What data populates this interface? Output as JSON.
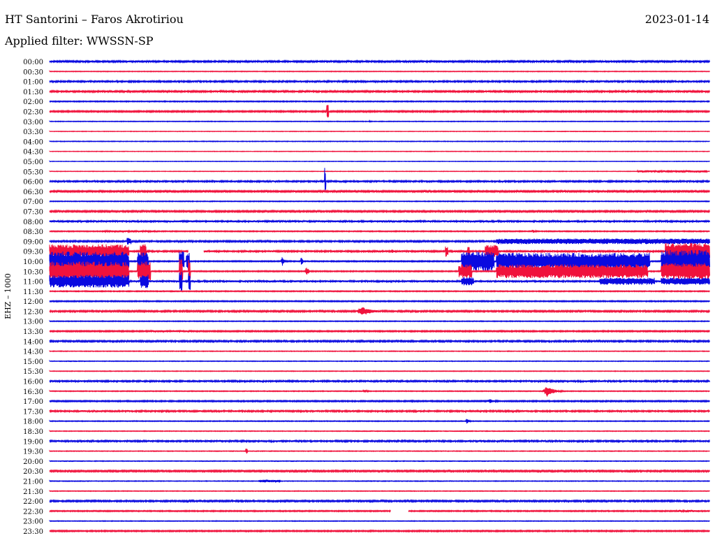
{
  "header": {
    "title": "HT Santorini – Faros Akrotiriou",
    "date": "2023-01-14",
    "filter": "Applied filter: WWSSN-SP"
  },
  "colors": {
    "blue": "#0a0ae0",
    "red": "#f0123c",
    "text": "#000000",
    "background": "#ffffff"
  },
  "chart_data": {
    "type": "line",
    "subtype": "helicorder",
    "ylabel": "EHZ – 1000",
    "row_labels": [
      "00:00",
      "00:30",
      "01:00",
      "01:30",
      "02:00",
      "02:30",
      "03:00",
      "03:30",
      "04:00",
      "04:30",
      "05:00",
      "05:30",
      "06:00",
      "06:30",
      "07:00",
      "07:30",
      "08:00",
      "08:30",
      "09:00",
      "09:30",
      "10:00",
      "10:30",
      "11:00",
      "11:30",
      "12:00",
      "12:30",
      "13:00",
      "13:30",
      "14:00",
      "14:30",
      "15:00",
      "15:30",
      "16:00",
      "16:30",
      "17:00",
      "17:30",
      "18:00",
      "18:30",
      "19:00",
      "19:30",
      "20:00",
      "20:30",
      "21:00",
      "21:30",
      "22:00",
      "22:30",
      "23:00",
      "23:30"
    ],
    "row_colors": [
      "blue",
      "red"
    ],
    "x_unit": "minutes within 30-minute row",
    "x_range": [
      0,
      30
    ],
    "baseline_noise": [
      1.2,
      0.5,
      1.3,
      1.2,
      0.7,
      1.0,
      0.5,
      0.4,
      0.5,
      0.4,
      0.4,
      0.4,
      1.3,
      1.1,
      0.6,
      1.1,
      1.4,
      0.7,
      1.2,
      1.3,
      0.8,
      0.8,
      1.4,
      0.7,
      0.8,
      1.2,
      0.6,
      0.9,
      1.2,
      0.5,
      0.5,
      0.5,
      1.3,
      0.6,
      0.9,
      1.3,
      0.6,
      0.5,
      1.3,
      0.5,
      0.5,
      1.1,
      0.5,
      0.5,
      1.2,
      0.8,
      0.5,
      0.9
    ],
    "events": [
      {
        "row": 5,
        "start": 12.6,
        "duration": 0.08,
        "amp": 10,
        "type": "spike"
      },
      {
        "row": 6,
        "start": 14.5,
        "duration": 0.2,
        "amp": 1.5,
        "type": "burst"
      },
      {
        "row": 11,
        "start": 26.7,
        "duration": 3.2,
        "amp": 1.6,
        "type": "noise"
      },
      {
        "row": 12,
        "start": 12.5,
        "duration": 0.05,
        "amp": 20,
        "type": "spike"
      },
      {
        "row": 17,
        "start": 2.4,
        "duration": 2.5,
        "amp": 1.5,
        "type": "noise"
      },
      {
        "row": 17,
        "start": 21.9,
        "duration": 0.4,
        "amp": 2.5,
        "type": "burst"
      },
      {
        "row": 18,
        "start": 3.5,
        "duration": 0.2,
        "amp": 5,
        "type": "spike"
      },
      {
        "row": 18,
        "start": 20.3,
        "duration": 9.7,
        "amp": 4,
        "type": "noise"
      },
      {
        "row": 19,
        "start": 0.0,
        "duration": 3.6,
        "amp": 10,
        "type": "noise"
      },
      {
        "row": 19,
        "start": 4.1,
        "duration": 0.3,
        "amp": 10,
        "type": "spike"
      },
      {
        "row": 19,
        "start": 15.5,
        "duration": 0.3,
        "amp": 4,
        "type": "burst"
      },
      {
        "row": 19,
        "start": 18.0,
        "duration": 0.1,
        "amp": 8,
        "type": "spike"
      },
      {
        "row": 19,
        "start": 19.0,
        "duration": 0.1,
        "amp": 8,
        "type": "spike"
      },
      {
        "row": 19,
        "start": 19.8,
        "duration": 0.6,
        "amp": 9,
        "type": "noise"
      },
      {
        "row": 19,
        "start": 28.0,
        "duration": 2.0,
        "amp": 12,
        "type": "noise"
      },
      {
        "row": 20,
        "start": 0.0,
        "duration": 3.6,
        "amp": 14,
        "type": "noise"
      },
      {
        "row": 20,
        "start": 4.0,
        "duration": 0.5,
        "amp": 13,
        "type": "noise"
      },
      {
        "row": 20,
        "start": 5.9,
        "duration": 0.2,
        "amp": 14,
        "type": "spike"
      },
      {
        "row": 20,
        "start": 6.2,
        "duration": 0.15,
        "amp": 14,
        "type": "spike"
      },
      {
        "row": 20,
        "start": 10.5,
        "duration": 0.3,
        "amp": 7,
        "type": "burst"
      },
      {
        "row": 20,
        "start": 11.4,
        "duration": 0.1,
        "amp": 5,
        "type": "spike"
      },
      {
        "row": 20,
        "start": 18.7,
        "duration": 1.5,
        "amp": 14,
        "type": "noise"
      },
      {
        "row": 20,
        "start": 20.3,
        "duration": 7.0,
        "amp": 12,
        "type": "noise"
      },
      {
        "row": 20,
        "start": 27.8,
        "duration": 2.2,
        "amp": 16,
        "type": "noise"
      },
      {
        "row": 21,
        "start": 0.0,
        "duration": 3.6,
        "amp": 14,
        "type": "noise"
      },
      {
        "row": 21,
        "start": 4.0,
        "duration": 0.6,
        "amp": 14,
        "type": "noise"
      },
      {
        "row": 21,
        "start": 5.9,
        "duration": 0.15,
        "amp": 18,
        "type": "spike"
      },
      {
        "row": 21,
        "start": 6.3,
        "duration": 0.1,
        "amp": 18,
        "type": "spike"
      },
      {
        "row": 21,
        "start": 11.6,
        "duration": 0.35,
        "amp": 7,
        "type": "burst"
      },
      {
        "row": 21,
        "start": 18.6,
        "duration": 0.6,
        "amp": 10,
        "type": "noise"
      },
      {
        "row": 21,
        "start": 20.3,
        "duration": 6.9,
        "amp": 10,
        "type": "noise"
      },
      {
        "row": 21,
        "start": 27.8,
        "duration": 2.2,
        "amp": 12,
        "type": "noise"
      },
      {
        "row": 22,
        "start": 0.0,
        "duration": 3.6,
        "amp": 9,
        "type": "noise"
      },
      {
        "row": 22,
        "start": 4.1,
        "duration": 0.4,
        "amp": 10,
        "type": "noise"
      },
      {
        "row": 22,
        "start": 5.9,
        "duration": 0.1,
        "amp": 14,
        "type": "spike"
      },
      {
        "row": 22,
        "start": 6.3,
        "duration": 0.1,
        "amp": 14,
        "type": "spike"
      },
      {
        "row": 22,
        "start": 18.7,
        "duration": 0.6,
        "amp": 6,
        "type": "noise"
      },
      {
        "row": 22,
        "start": 25.0,
        "duration": 2.5,
        "amp": 5,
        "type": "noise"
      },
      {
        "row": 22,
        "start": 27.8,
        "duration": 2.2,
        "amp": 5,
        "type": "noise"
      },
      {
        "row": 25,
        "start": 13.9,
        "duration": 1.4,
        "amp": 7,
        "type": "burst"
      },
      {
        "row": 27,
        "start": 4.5,
        "duration": 2.0,
        "amp": 1.5,
        "type": "noise"
      },
      {
        "row": 33,
        "start": 14.2,
        "duration": 0.5,
        "amp": 2.5,
        "type": "burst"
      },
      {
        "row": 33,
        "start": 22.4,
        "duration": 1.0,
        "amp": 8,
        "type": "burst"
      },
      {
        "row": 34,
        "start": 19.8,
        "duration": 1.0,
        "amp": 3,
        "type": "burst"
      },
      {
        "row": 36,
        "start": 18.9,
        "duration": 0.3,
        "amp": 4.5,
        "type": "burst"
      },
      {
        "row": 39,
        "start": 8.9,
        "duration": 0.1,
        "amp": 4,
        "type": "spike"
      },
      {
        "row": 42,
        "start": 9.5,
        "duration": 1.0,
        "amp": 2,
        "type": "noise"
      },
      {
        "row": 45,
        "start": 28.5,
        "duration": 1.0,
        "amp": 1.5,
        "type": "noise"
      }
    ],
    "gaps": [
      {
        "row": 19,
        "start": 6.3,
        "duration": 0.7
      },
      {
        "row": 45,
        "start": 15.5,
        "duration": 0.8
      }
    ]
  }
}
